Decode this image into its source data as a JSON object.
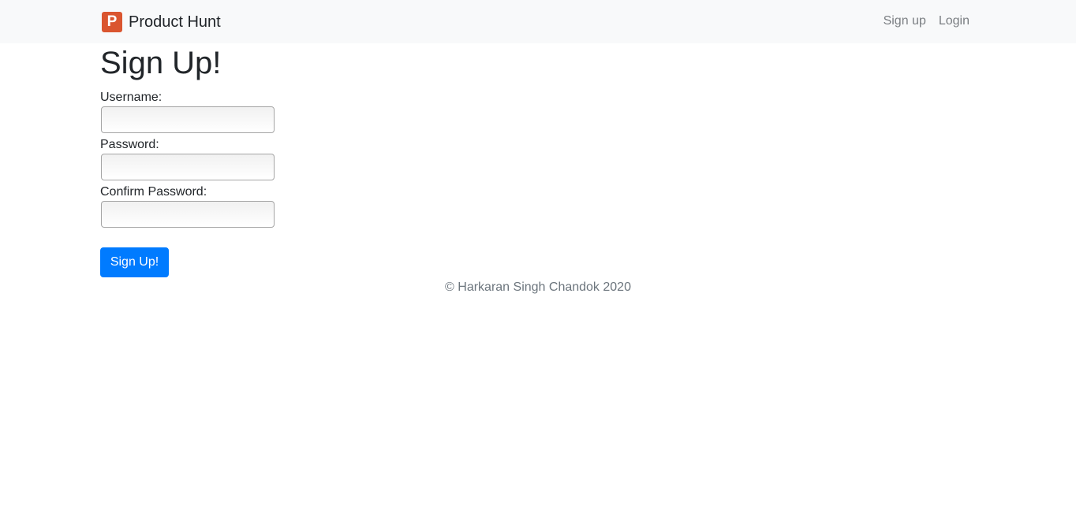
{
  "navbar": {
    "brand_logo_letter": "P",
    "brand_name": "Product Hunt",
    "links": [
      {
        "label": "Sign up"
      },
      {
        "label": "Login"
      }
    ],
    "background_color": "#f8f9fa"
  },
  "form": {
    "title": "Sign Up!",
    "fields": [
      {
        "label": "Username:",
        "value": "",
        "placeholder": ""
      },
      {
        "label": "Password:",
        "value": "",
        "placeholder": ""
      },
      {
        "label": "Confirm Password:",
        "value": "",
        "placeholder": ""
      }
    ],
    "submit_label": "Sign Up!",
    "accent_color": "#007bff"
  },
  "footer": {
    "text": "© Harkaran Singh Chandok 2020"
  },
  "icons": {
    "brand_logo": "product-hunt-logo-icon",
    "brand_color": "#da552f"
  }
}
